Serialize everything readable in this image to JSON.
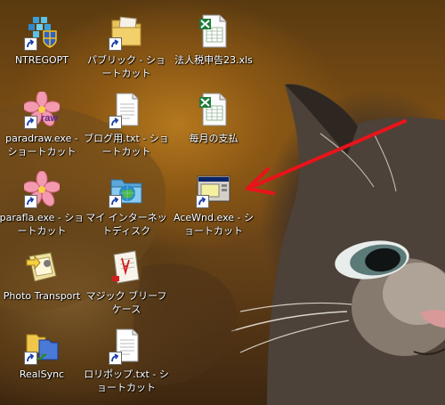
{
  "desktop": {
    "icons": [
      {
        "label": "NTREGOPT",
        "icon": "ntregopt-app-icon",
        "shortcut": true
      },
      {
        "label": "パブリック - ショートカット",
        "icon": "folder-icon",
        "shortcut": true
      },
      {
        "label": "法人税申告23.xls",
        "icon": "excel-file-icon",
        "shortcut": false
      },
      {
        "label": "paradraw.exe - ショートカット",
        "icon": "paradraw-icon",
        "shortcut": true
      },
      {
        "label": "ブログ用.txt - ショートカット",
        "icon": "text-file-icon",
        "shortcut": true
      },
      {
        "label": "毎月の支払",
        "icon": "excel-file-icon",
        "shortcut": false
      },
      {
        "label": "parafla.exe - ショートカット",
        "icon": "parafla-icon",
        "shortcut": true
      },
      {
        "label": "マイ インターネットディスク",
        "icon": "internet-disk-icon",
        "shortcut": true
      },
      {
        "label": "AceWnd.exe - ショートカット",
        "icon": "window-app-icon",
        "shortcut": true
      },
      {
        "label": "Photo Transport",
        "icon": "photo-transport-icon",
        "shortcut": false
      },
      {
        "label": "マジック ブリーフケース",
        "icon": "briefcase-icon",
        "shortcut": false
      },
      {
        "label": "RealSync",
        "icon": "realsync-icon",
        "shortcut": true
      },
      {
        "label": "ロリポップ.txt - ショートカット",
        "icon": "text-file-icon",
        "shortcut": true
      }
    ],
    "annotation": {
      "color": "#e8141a",
      "icon": "red-arrow"
    }
  }
}
